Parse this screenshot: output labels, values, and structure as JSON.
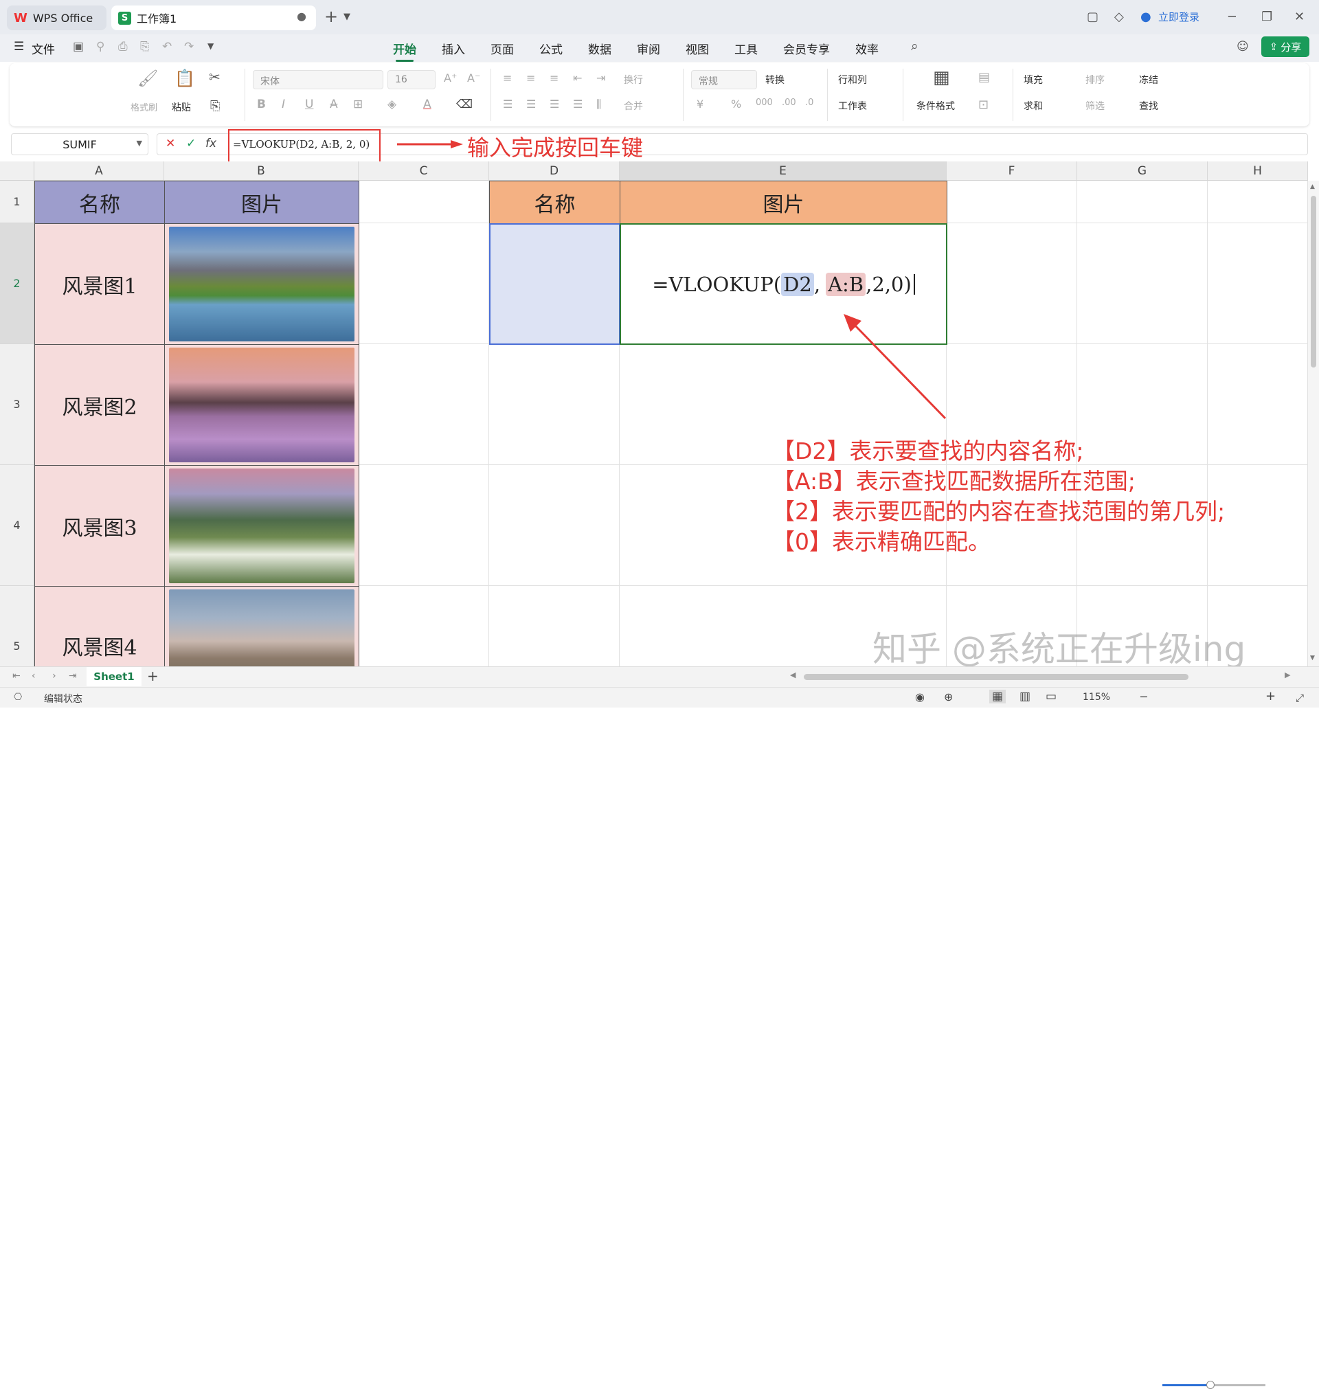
{
  "tabs": [
    {
      "label": "WPS Office"
    },
    {
      "label": "工作簿1"
    }
  ],
  "titlebar": {
    "login": "立即登录"
  },
  "menu": {
    "file": "文件",
    "items": [
      "开始",
      "插入",
      "页面",
      "公式",
      "数据",
      "审阅",
      "视图",
      "工具",
      "会员专享",
      "效率"
    ],
    "active": "开始",
    "share": "分享"
  },
  "ribbon": {
    "format_painter": "格式刷",
    "paste": "粘贴",
    "font_name": "宋体",
    "font_size": "16",
    "wrap": "换行",
    "merge": "合并",
    "number_format": "常规",
    "convert": "转换",
    "row_col": "行和列",
    "worksheet": "工作表",
    "cond_format": "条件格式",
    "fill": "填充",
    "sort": "排序",
    "freeze": "冻结",
    "sum": "求和",
    "filter": "筛选",
    "find": "查找"
  },
  "formula_bar": {
    "name_box": "SUMIF",
    "formula": "=VLOOKUP(D2, A:B, 2, 0)",
    "fx": "fx"
  },
  "annotation_top": "输入完成按回车键",
  "columns": [
    "A",
    "B",
    "C",
    "D",
    "E",
    "F",
    "G",
    "H"
  ],
  "rows": [
    "1",
    "2",
    "3",
    "4",
    "5"
  ],
  "sheet": {
    "a1": "名称",
    "b1": "图片",
    "a_values": [
      "风景图1",
      "风景图2",
      "风景图3",
      "风景图4"
    ],
    "d1": "名称",
    "e1": "图片",
    "e2_formula": {
      "prefix": "=VLOOKUP(",
      "arg1": "D2",
      "comma1": ",",
      "arg2": "A:B",
      "rest": ",2,0)"
    }
  },
  "explanations": [
    "【D2】表示要查找的内容名称;",
    "【A:B】表示查找匹配数据所在范围;",
    "【2】表示要匹配的内容在查找范围的第几列;",
    "【0】表示精确匹配。"
  ],
  "watermark": "知乎 @系统正在升级ing",
  "sheet_tab": "Sheet1",
  "status": {
    "mode": "编辑状态",
    "zoom": "115%"
  },
  "colors": {
    "accent": "#1a7f4b",
    "annotation": "#e53935",
    "header_purple": "#9d9dcc",
    "header_orange": "#f4b183",
    "pink": "#f6dcdc",
    "selection_blue": "#dde3f4"
  }
}
